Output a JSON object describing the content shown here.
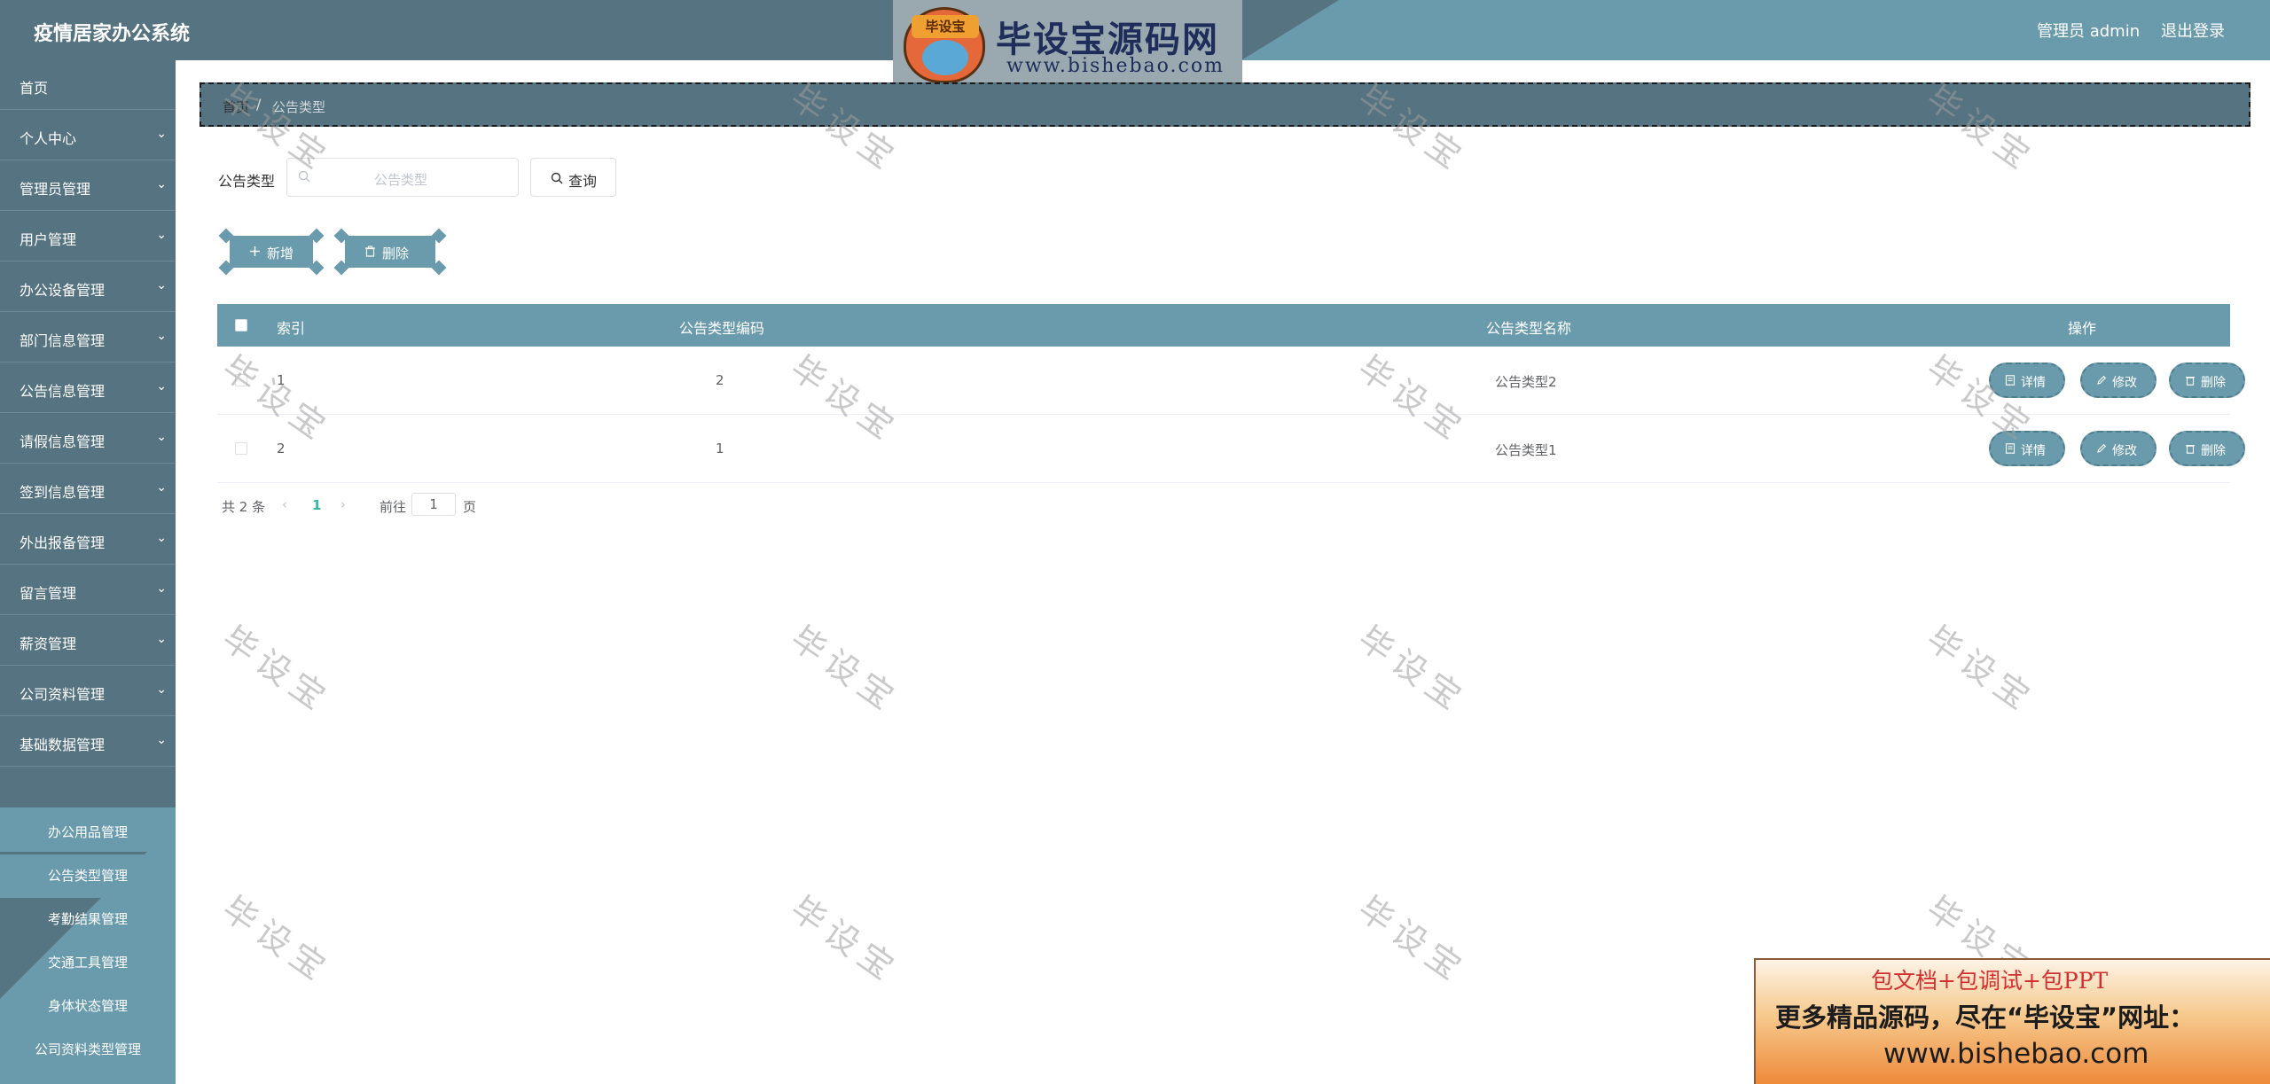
{
  "header": {
    "app_title": "疫情居家办公系统",
    "user_label": "管理员 admin",
    "logout_label": "退出登录"
  },
  "logo": {
    "badge_text": "毕设宝",
    "title": "毕设宝源码网",
    "url": "www.bishebao.com"
  },
  "sidebar": {
    "items": [
      {
        "label": "首页",
        "has_arrow": false
      },
      {
        "label": "个人中心",
        "has_arrow": true
      },
      {
        "label": "管理员管理",
        "has_arrow": true
      },
      {
        "label": "用户管理",
        "has_arrow": true
      },
      {
        "label": "办公设备管理",
        "has_arrow": true
      },
      {
        "label": "部门信息管理",
        "has_arrow": true
      },
      {
        "label": "公告信息管理",
        "has_arrow": true
      },
      {
        "label": "请假信息管理",
        "has_arrow": true
      },
      {
        "label": "签到信息管理",
        "has_arrow": true
      },
      {
        "label": "外出报备管理",
        "has_arrow": true
      },
      {
        "label": "留言管理",
        "has_arrow": true
      },
      {
        "label": "薪资管理",
        "has_arrow": true
      },
      {
        "label": "公司资料管理",
        "has_arrow": true
      },
      {
        "label": "基础数据管理",
        "has_arrow": true
      }
    ],
    "sub_items": [
      {
        "label": "办公用品管理",
        "active": false
      },
      {
        "label": "公告类型管理",
        "active": true
      },
      {
        "label": "考勤结果管理",
        "active": false
      },
      {
        "label": "交通工具管理",
        "active": false
      },
      {
        "label": "身体状态管理",
        "active": false
      },
      {
        "label": "公司资料类型管理",
        "active": false
      }
    ]
  },
  "breadcrumb": {
    "home": "首页",
    "separator": "/",
    "current": "公告类型"
  },
  "search": {
    "label": "公告类型",
    "placeholder": "公告类型",
    "button_label": "查询"
  },
  "toolbar": {
    "add_label": "新增",
    "delete_label": "删除"
  },
  "table": {
    "columns": [
      "索引",
      "公告类型编码",
      "公告类型名称",
      "操作"
    ],
    "rows": [
      {
        "index": "1",
        "code": "2",
        "name": "公告类型2"
      },
      {
        "index": "2",
        "code": "1",
        "name": "公告类型1"
      }
    ],
    "actions": {
      "detail": "详情",
      "edit": "修改",
      "delete": "删除"
    }
  },
  "pagination": {
    "total": "共 2 条",
    "prev": "‹",
    "current_page": "1",
    "next": "›",
    "goto_label": "前往",
    "page_input_value": "1",
    "unit": "页"
  },
  "watermark": {
    "text": "毕设宝"
  },
  "ad": {
    "line1": "包文档+包调试+包PPT",
    "line2": "更多精品源码，尽在“毕设宝”网址：",
    "line3": "www.bishebao.com"
  },
  "colors": {
    "primary": "#557380",
    "accent": "#6a9bad",
    "page_active": "#2fb8a8"
  }
}
